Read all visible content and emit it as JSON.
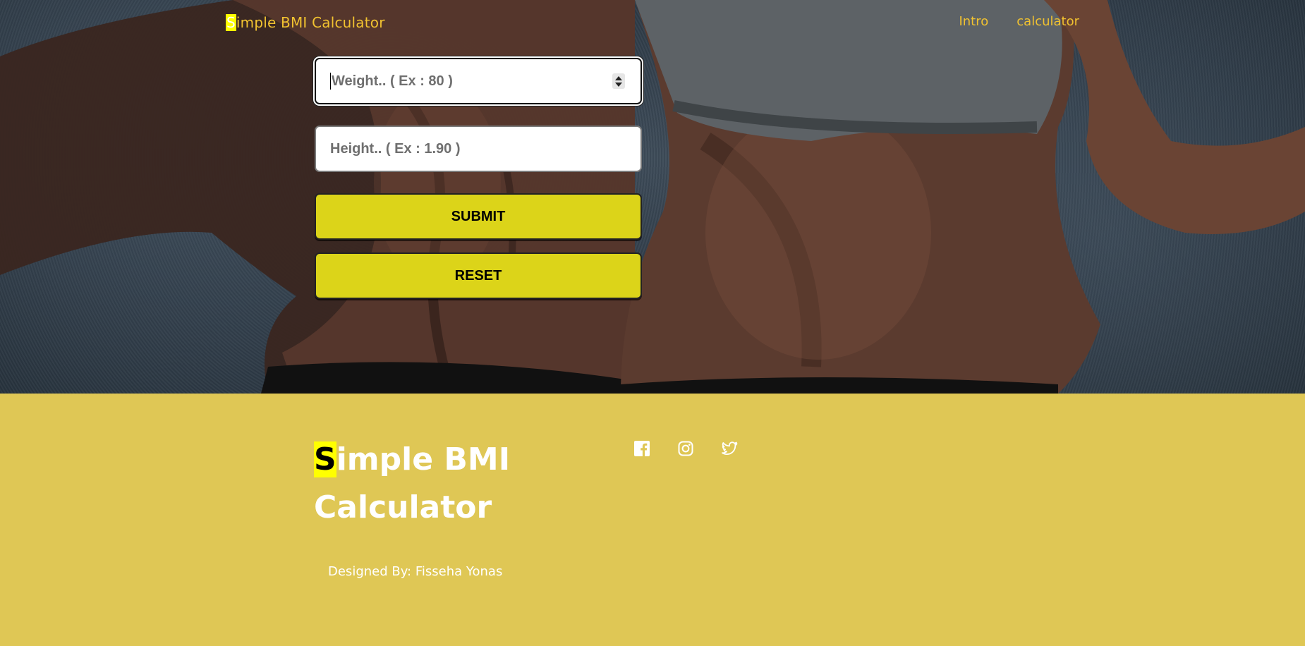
{
  "header": {
    "brand_first_letter": "S",
    "brand_rest": "imple BMI Calculator",
    "nav": [
      {
        "label": "Intro"
      },
      {
        "label": "calculator"
      }
    ]
  },
  "form": {
    "weight_placeholder": "Weight.. ( Ex : 80 )",
    "height_placeholder": "Height.. ( Ex : 1.90 )",
    "submit_label": "SUBMIT",
    "reset_label": "RESET"
  },
  "footer": {
    "title_first_letter": "S",
    "title_line1_rest": "imple BMI",
    "title_line2": "Calculator",
    "credit": "Designed By: Fisseha Yonas",
    "social_icons": [
      "facebook-icon",
      "instagram-icon",
      "twitter-icon"
    ]
  },
  "colors": {
    "accent_yellow": "#f1c230",
    "highlight": "#ffff00",
    "button_bg": "#dcd419",
    "footer_bg": "#dfc755"
  }
}
